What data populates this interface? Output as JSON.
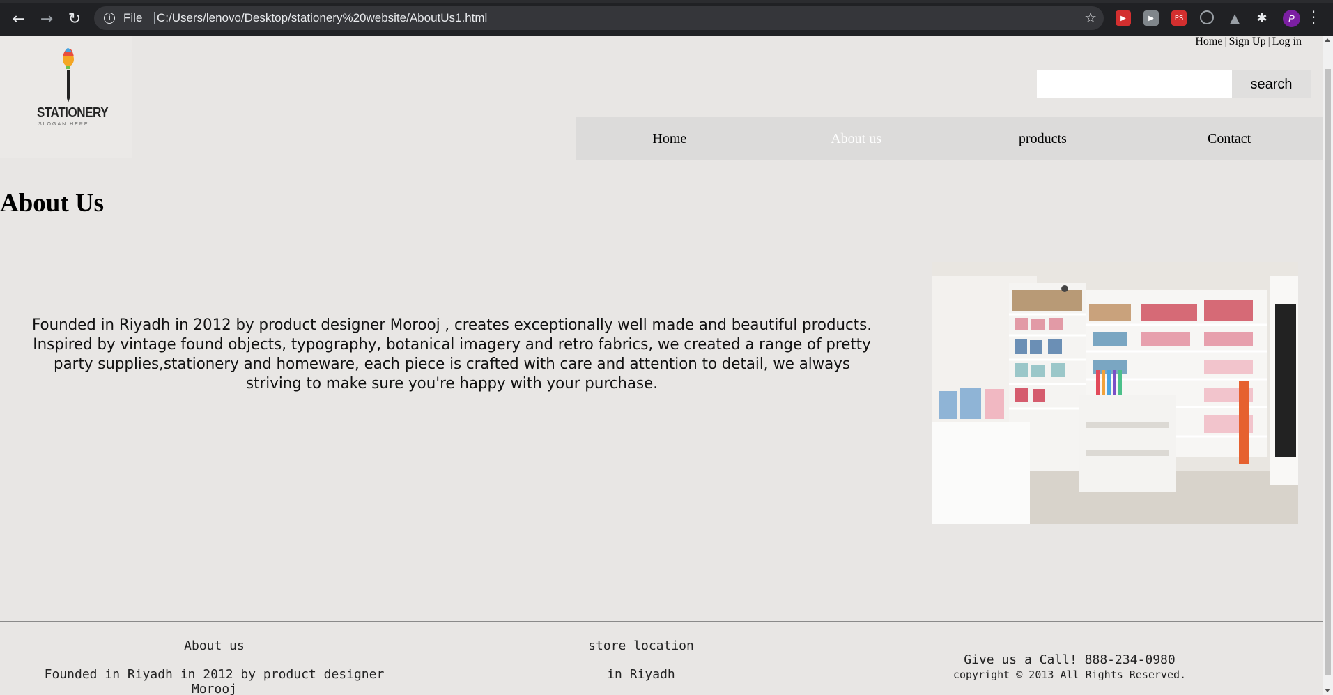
{
  "browser": {
    "file_label": "File",
    "url": "C:/Users/lenovo/Desktop/stationery%20website/AboutUs1.html",
    "profile_initial": "P",
    "extensions": [
      "youtube-icon",
      "video-icon",
      "ps-extension-icon",
      "speed-icon",
      "drive-icon",
      "puzzle-icon"
    ]
  },
  "top_links": {
    "home": "Home",
    "separator": "|",
    "signup": "Sign Up",
    "login": "Log in"
  },
  "logo": {
    "name": "STATIONERY",
    "slogan": "SLOGAN HERE"
  },
  "search": {
    "placeholder": "",
    "button_label": "search"
  },
  "nav": {
    "items": [
      {
        "label": "Home"
      },
      {
        "label": "About us"
      },
      {
        "label": "products"
      },
      {
        "label": "Contact"
      }
    ],
    "active_index": 1
  },
  "page": {
    "title": "About Us",
    "body": "Founded in Riyadh in 2012 by product designer Morooj , creates exceptionally well made and beautiful products. Inspired by vintage found objects, typography, botanical imagery and retro fabrics, we created a range of pretty party supplies,stationery and homeware, each piece is crafted with care and attention to detail, we always striving to make sure you're happy with your purchase."
  },
  "footer": {
    "about_heading": "About us",
    "about_text": "Founded in Riyadh in 2012 by product designer Morooj",
    "location_heading": "store location",
    "location_text": "in Riyadh",
    "call_text": "Give us a Call! 888-234-0980",
    "copyright": "copyright © 2013 All Rights Reserved."
  },
  "colors": {
    "page_bg": "#e8e6e4",
    "nav_bg": "#dcdbda",
    "active_nav_text": "#ffffff",
    "chrome_bg": "#202124"
  }
}
